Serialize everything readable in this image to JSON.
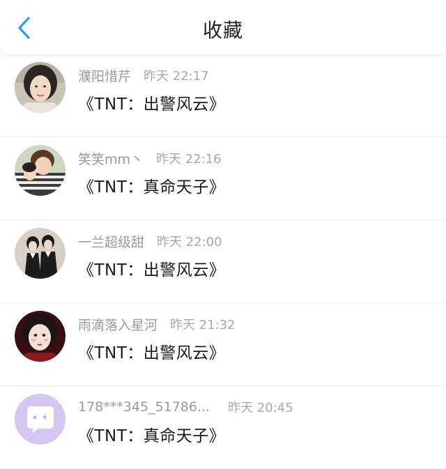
{
  "header": {
    "title": "收藏",
    "back_icon": "chevron-left-icon",
    "accent_color": "#2c9af2"
  },
  "items": [
    {
      "username": "濮阳惜芹",
      "time": "昨天 22:17",
      "title": "《TNT：出警风云》",
      "avatar": "portrait-photo"
    },
    {
      "username": "笑笑mm丶",
      "time": "昨天 22:16",
      "title": "《TNT：真命天子》",
      "avatar": "portrait-photo"
    },
    {
      "username": "一兰超级甜",
      "time": "昨天 22:00",
      "title": "《TNT：出警风云》",
      "avatar": "portrait-photo"
    },
    {
      "username": "雨滴落入星河",
      "time": "昨天 21:32",
      "title": "《TNT：出警风云》",
      "avatar": "portrait-photo"
    },
    {
      "username": "178***345_51786...",
      "time": "昨天 20:45",
      "title": "《TNT：真命天子》",
      "avatar": "default-chat-bubble-icon"
    }
  ]
}
